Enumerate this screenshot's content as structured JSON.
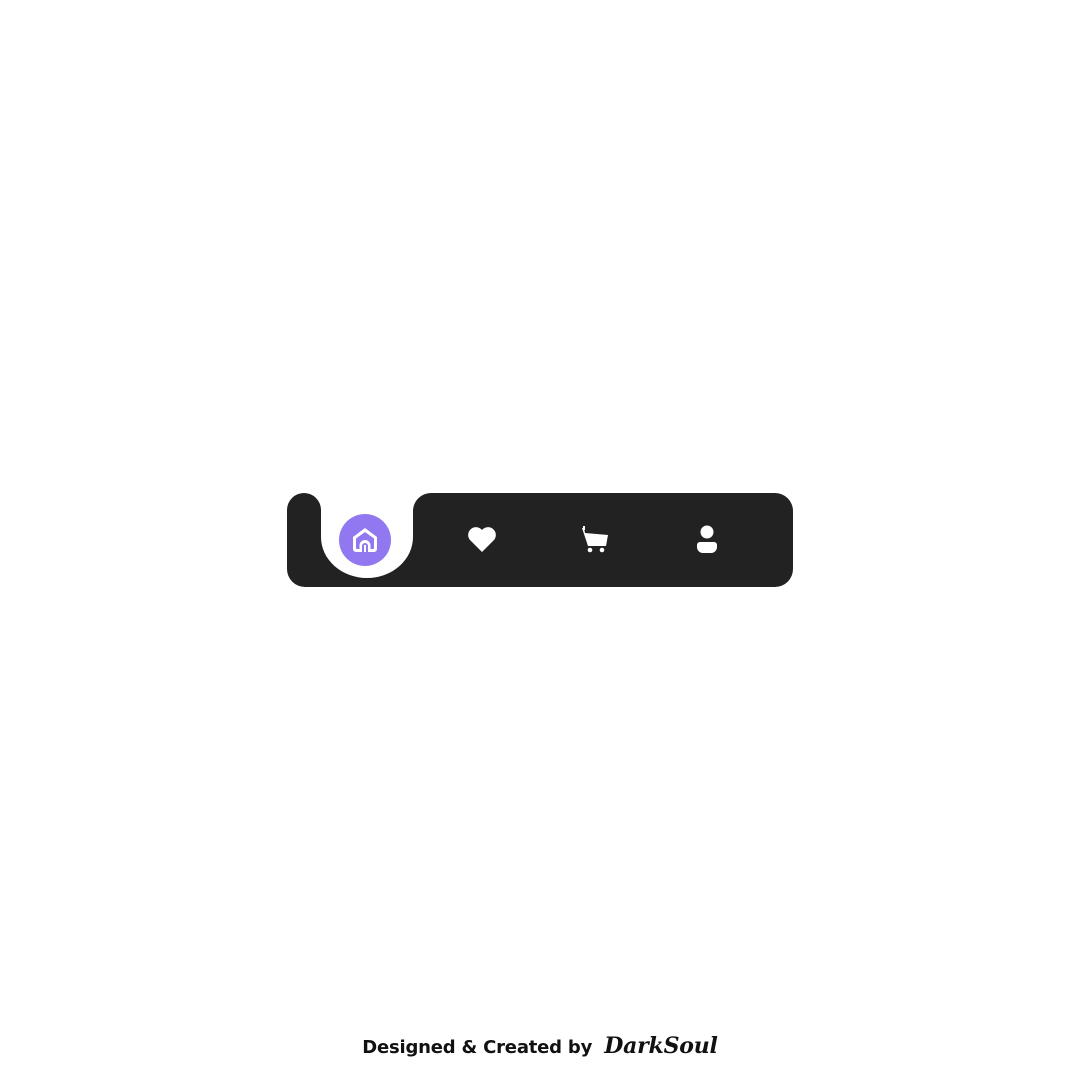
{
  "colors": {
    "background": "#ffffff",
    "bar": "#222222",
    "active_accent": "#9178f0",
    "icon": "#ffffff",
    "text": "#111111"
  },
  "tabbar": {
    "active_tab": "home",
    "tabs": [
      {
        "id": "home",
        "icon": "home-icon",
        "active": true
      },
      {
        "id": "favorites",
        "icon": "heart-icon",
        "active": false
      },
      {
        "id": "cart",
        "icon": "cart-icon",
        "active": false
      },
      {
        "id": "profile",
        "icon": "user-icon",
        "active": false
      }
    ]
  },
  "footer": {
    "credit_text": "Designed & Created by",
    "author": "DarkSoul"
  }
}
